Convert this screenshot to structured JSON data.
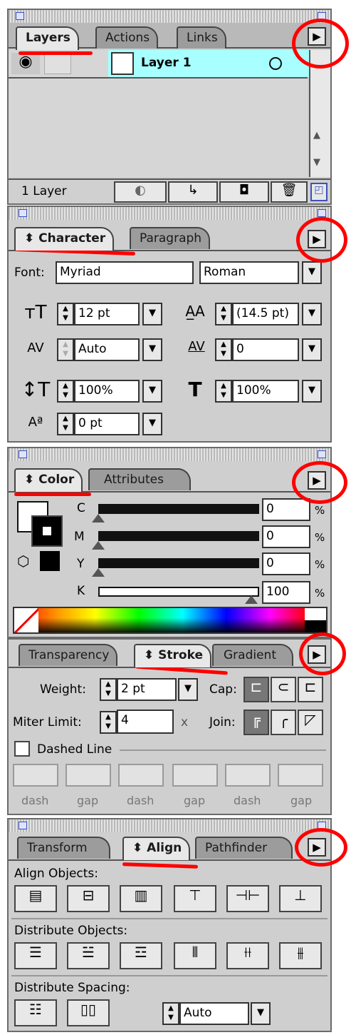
{
  "layers_panel": {
    "tabs": [
      "Layers",
      "Actions",
      "Links"
    ],
    "layer_name": "Layer 1",
    "count": "1 Layer"
  },
  "character_panel": {
    "tabs": [
      "Character",
      "Paragraph"
    ],
    "font_label": "Font:",
    "font": "Myriad",
    "style": "Roman",
    "size": "12 pt",
    "leading": "(14.5 pt)",
    "kerning": "Auto",
    "tracking": "0",
    "vscale": "100%",
    "hscale": "100%",
    "baseline": "0 pt"
  },
  "color_panel": {
    "tabs": [
      "Color",
      "Attributes"
    ],
    "channels": [
      {
        "label": "C",
        "value": "0"
      },
      {
        "label": "M",
        "value": "0"
      },
      {
        "label": "Y",
        "value": "0"
      },
      {
        "label": "K",
        "value": "100"
      }
    ],
    "pct": "%"
  },
  "stroke_panel": {
    "tabs": [
      "Transparency",
      "Stroke",
      "Gradient"
    ],
    "weight_label": "Weight:",
    "weight": "2 pt",
    "cap_label": "Cap:",
    "miter_label": "Miter Limit:",
    "miter": "4",
    "times": "x",
    "join_label": "Join:",
    "dashed_label": "Dashed Line",
    "dash_labels": [
      "dash",
      "gap",
      "dash",
      "gap",
      "dash",
      "gap"
    ]
  },
  "align_panel": {
    "tabs": [
      "Transform",
      "Align",
      "Pathfinder"
    ],
    "align_objects": "Align Objects:",
    "distribute_objects": "Distribute Objects:",
    "distribute_spacing": "Distribute Spacing:",
    "spacing_value": "Auto"
  },
  "icons": {
    "menu": "triangle-right",
    "eye": "eye",
    "dropdown": "triangle-down",
    "spinner": "updown-arrows"
  },
  "colors": {
    "layer_highlight": "#a8ffff",
    "annotation": "#ff0000",
    "panel": "#cfcfcf"
  }
}
